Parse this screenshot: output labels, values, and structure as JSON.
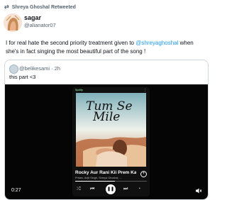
{
  "retweet": {
    "label": "Shreya Ghoshal Retweeted"
  },
  "tweet": {
    "author_name": "sagar",
    "author_handle": "@alianator07",
    "text_before": "I for real hate the second priority treatment given to ",
    "mention": "@shreyaghoshal",
    "text_after": " when she's in fact singing the most beautiful part of the song !"
  },
  "quote": {
    "handle_time": "@belikesami · 2h",
    "text": "this part <3",
    "video": {
      "elapsed": "0:27",
      "player": {
        "badge": "Spotify",
        "cover_title_line1": "Tum Se",
        "cover_title_line2": "Mile",
        "song_title": "Rocky Aur Rani Kii Prem Kahani",
        "song_artists": "Pritam, Arijit Singh, Shreya Ghoshal, ...",
        "progress": 0.55
      }
    }
  },
  "colors": {
    "link": "#1d9bf0",
    "muted": "#536471"
  }
}
